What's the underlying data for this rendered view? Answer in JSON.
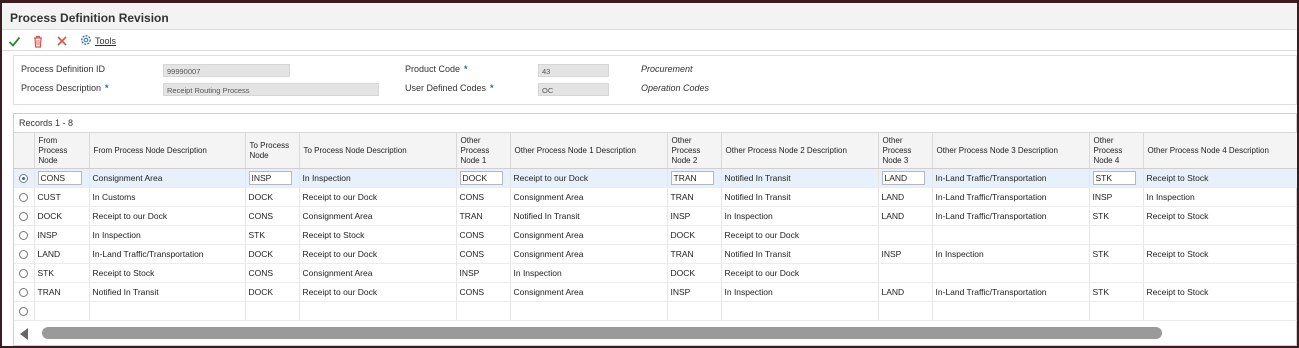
{
  "window": {
    "title": "Process Definition Revision"
  },
  "toolbar": {
    "icons": [
      "checkmark-icon",
      "trash-icon",
      "close-icon",
      "gear-icon"
    ],
    "tools_label": "Tools"
  },
  "header": {
    "process_definition_id_label": "Process Definition ID",
    "process_definition_id_value": "99990007",
    "process_description_label": "Process Description",
    "process_description_value": "Receipt Routing Process",
    "product_code_label": "Product Code",
    "product_code_value": "43",
    "product_code_desc": "Procurement",
    "user_defined_codes_label": "User Defined Codes",
    "user_defined_codes_value": "OC",
    "user_defined_codes_desc": "Operation Codes",
    "required_mark": "*"
  },
  "grid": {
    "records_label": "Records 1 - 8",
    "columns": [
      "From Process Node",
      "From Process Node Description",
      "To Process Node",
      "To Process Node Description",
      "Other Process Node 1",
      "Other Process Node 1 Description",
      "Other Process Node 2",
      "Other Process Node 2 Description",
      "Other Process Node 3",
      "Other Process Node 3 Description",
      "Other Process Node 4",
      "Other Process Node 4 Description"
    ],
    "rows": [
      [
        "CONS",
        "Consignment Area",
        "INSP",
        "In Inspection",
        "DOCK",
        "Receipt to our Dock",
        "TRAN",
        "Notified In Transit",
        "LAND",
        "In-Land Traffic/Transportation",
        "STK",
        "Receipt to Stock"
      ],
      [
        "CUST",
        "In Customs",
        "DOCK",
        "Receipt to our Dock",
        "CONS",
        "Consignment Area",
        "TRAN",
        "Notified In Transit",
        "LAND",
        "In-Land Traffic/Transportation",
        "INSP",
        "In Inspection"
      ],
      [
        "DOCK",
        "Receipt to our Dock",
        "CONS",
        "Consignment Area",
        "TRAN",
        "Notified In Transit",
        "INSP",
        "In Inspection",
        "LAND",
        "In-Land Traffic/Transportation",
        "STK",
        "Receipt to Stock"
      ],
      [
        "INSP",
        "In Inspection",
        "STK",
        "Receipt to Stock",
        "CONS",
        "Consignment Area",
        "DOCK",
        "Receipt to our Dock",
        "",
        "",
        "",
        ""
      ],
      [
        "LAND",
        "In-Land Traffic/Transportation",
        "DOCK",
        "Receipt to our Dock",
        "CONS",
        "Consignment Area",
        "TRAN",
        "Notified In Transit",
        "INSP",
        "In Inspection",
        "STK",
        "Receipt to Stock"
      ],
      [
        "STK",
        "Receipt to Stock",
        "CONS",
        "Consignment Area",
        "INSP",
        "In Inspection",
        "DOCK",
        "Receipt to our Dock",
        "",
        "",
        "",
        ""
      ],
      [
        "TRAN",
        "Notified In Transit",
        "DOCK",
        "Receipt to our Dock",
        "CONS",
        "Consignment Area",
        "INSP",
        "In Inspection",
        "LAND",
        "In-Land Traffic/Transportation",
        "STK",
        "Receipt to Stock"
      ],
      [
        "",
        "",
        "",
        "",
        "",
        "",
        "",
        "",
        "",
        "",
        "",
        ""
      ]
    ],
    "selected_row": 0
  },
  "colors": {
    "accent": "#2b6cb3",
    "check": "#2e8b2e",
    "delete": "#d9534f",
    "frame": "#3a1c22"
  }
}
